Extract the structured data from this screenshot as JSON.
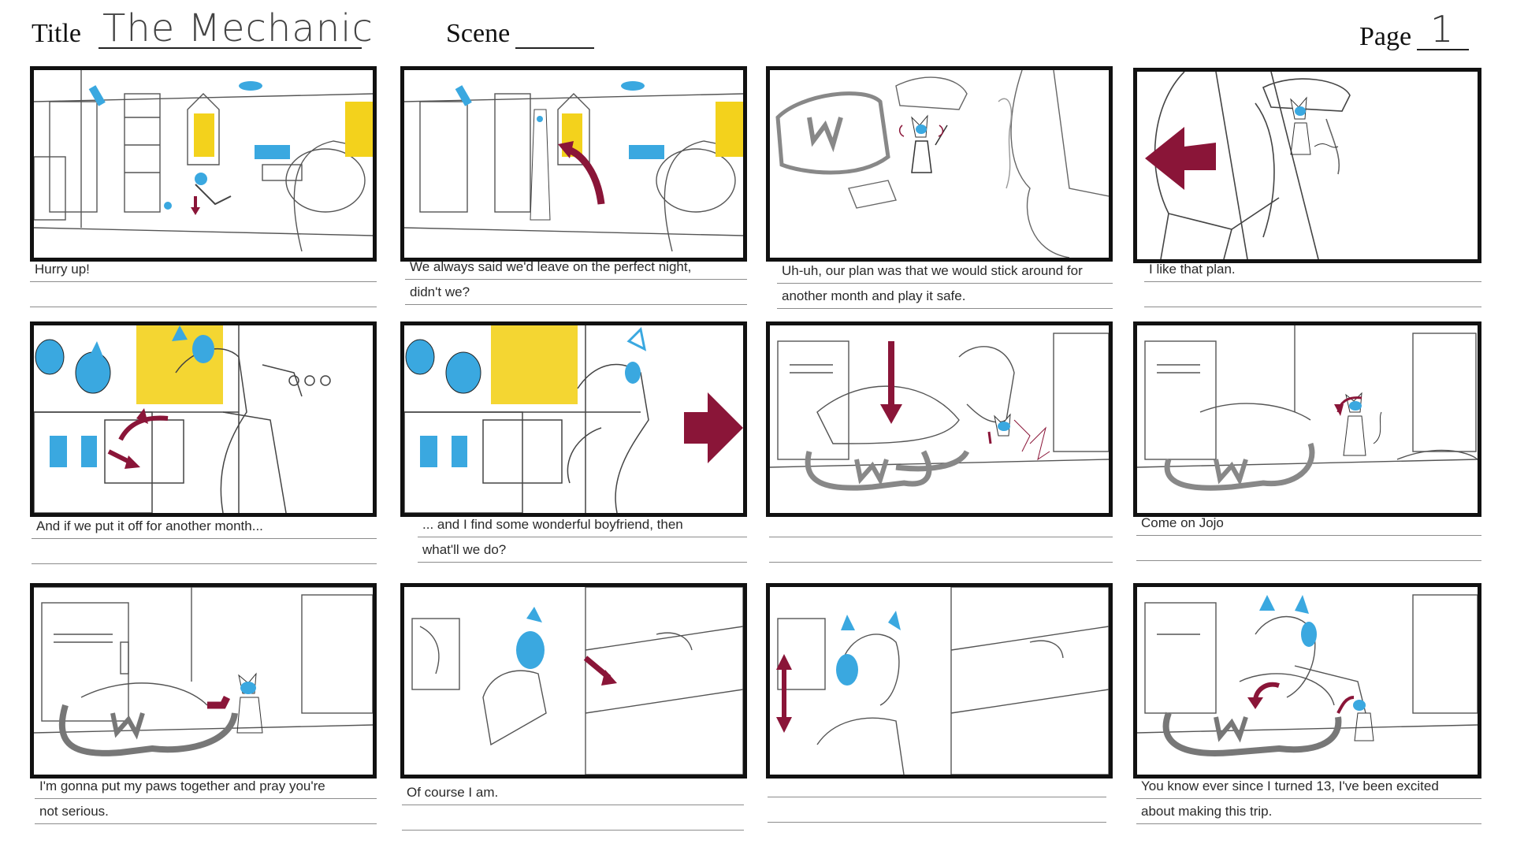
{
  "header": {
    "title_label": "Title",
    "title_value": "The Mechanic",
    "scene_label": "Scene",
    "scene_value": "",
    "page_label": "Page",
    "page_value": "1"
  },
  "panels": [
    {
      "caption": [
        "Hurry up!",
        ""
      ]
    },
    {
      "caption": [
        "We always said we'd leave on the perfect night,",
        "didn't we?"
      ]
    },
    {
      "caption": [
        "Uh-uh, our plan was that we would stick around for",
        "another month and play it safe."
      ]
    },
    {
      "caption": [
        "I like that plan.",
        ""
      ]
    },
    {
      "caption": [
        "And if we put it off for another month...",
        ""
      ]
    },
    {
      "caption": [
        "... and I find some wonderful boyfriend, then",
        "what'll we do?"
      ]
    },
    {
      "caption": [
        "",
        ""
      ]
    },
    {
      "caption": [
        "Come on Jojo",
        ""
      ]
    },
    {
      "caption": [
        "I'm gonna put my paws together and pray you're",
        "not serious."
      ]
    },
    {
      "caption": [
        "Of course I am.",
        ""
      ]
    },
    {
      "caption": [
        "",
        ""
      ]
    },
    {
      "caption": [
        "You know ever since I turned 13, I've been excited",
        "about making this trip."
      ]
    }
  ],
  "colors": {
    "accent_red": "#8a1538",
    "accent_blue": "#3aa8e0",
    "accent_yellow": "#f3d21c"
  }
}
